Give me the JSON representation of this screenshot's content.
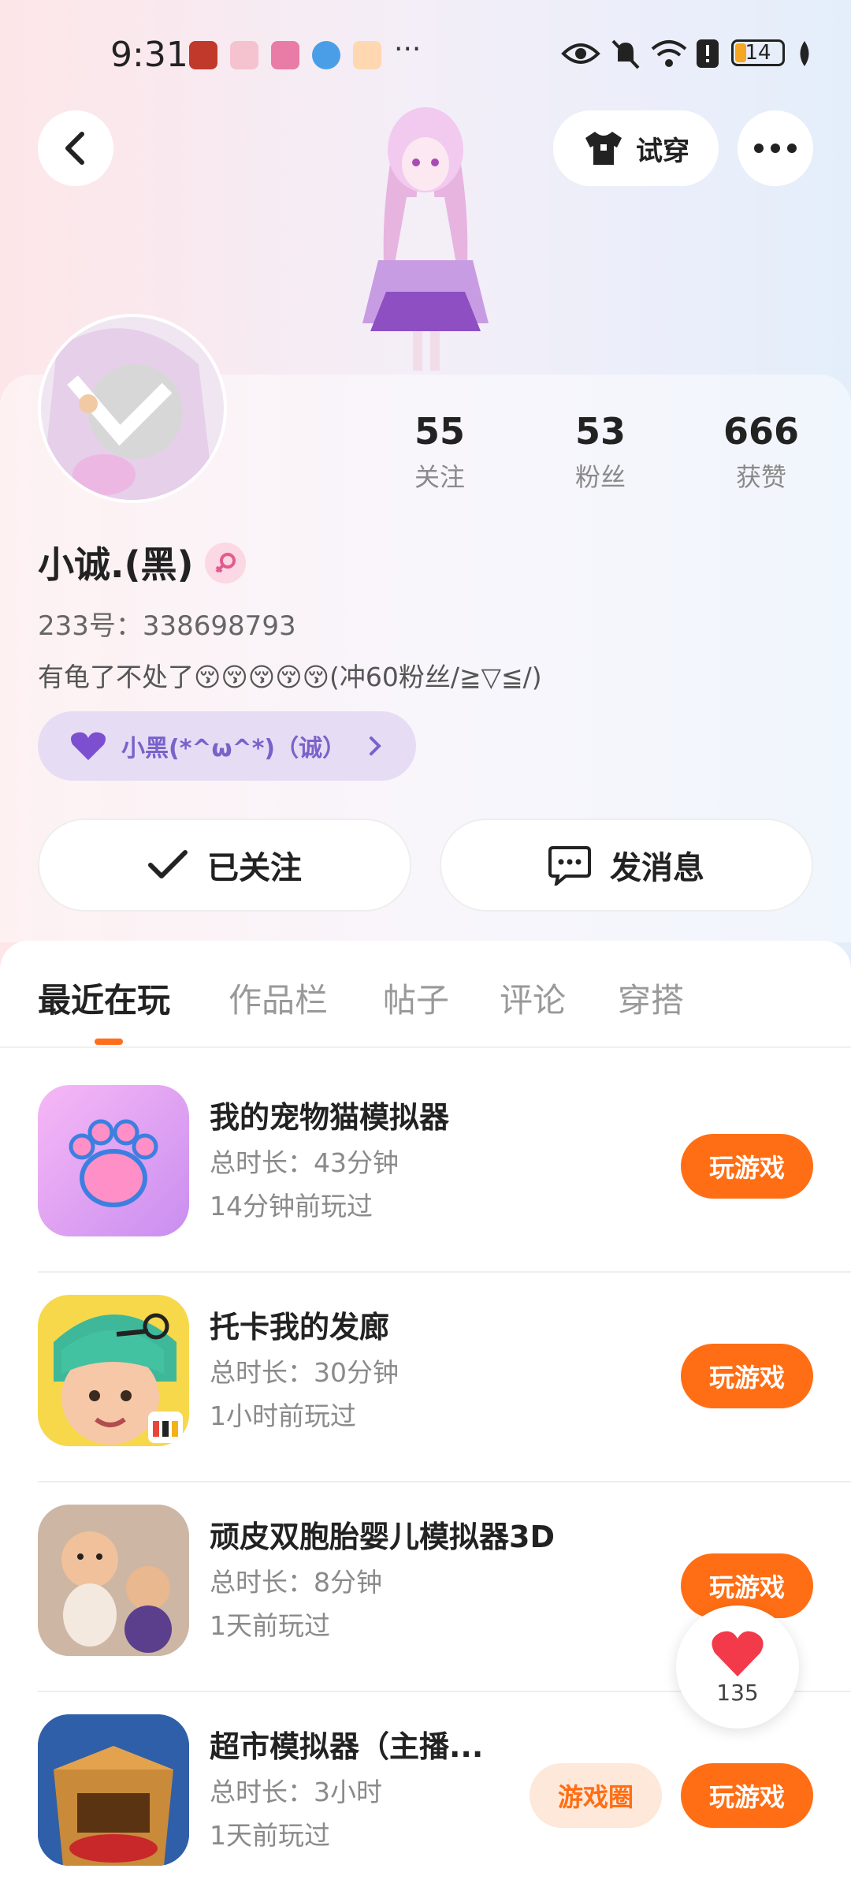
{
  "status_bar": {
    "time": "9:31",
    "more": "···",
    "battery": "14"
  },
  "header": {
    "tryon_label": "试穿"
  },
  "profile": {
    "stats": [
      {
        "num": "55",
        "label": "关注"
      },
      {
        "num": "53",
        "label": "粉丝"
      },
      {
        "num": "666",
        "label": "获赞"
      }
    ],
    "name": "小诚.(黑)",
    "id_text": "233号：338698793",
    "bio": "有龟了不处了😚😚😚😚😚(冲60粉丝/≧▽≦/)",
    "tag": "小黑(*^ω^*)（诚）"
  },
  "actions": {
    "followed": "已关注",
    "message": "发消息"
  },
  "tabs": [
    "最近在玩",
    "作品栏",
    "帖子",
    "评论",
    "穿搭"
  ],
  "games": [
    {
      "title": "我的宠物猫模拟器",
      "duration": "总时长：43分钟",
      "last": "14分钟前玩过",
      "play": "玩游戏"
    },
    {
      "title": "托卡我的发廊",
      "duration": "总时长：30分钟",
      "last": "1小时前玩过",
      "play": "玩游戏"
    },
    {
      "title": "顽皮双胞胎婴儿模拟器3D",
      "duration": "总时长：8分钟",
      "last": "1天前玩过",
      "play": "玩游戏"
    },
    {
      "title": "超市模拟器（主播...",
      "duration": "总时长：3小时",
      "last": "1天前玩过",
      "play": "玩游戏",
      "circle": "游戏圈"
    }
  ],
  "like_float": {
    "count": "135"
  },
  "colors": {
    "accent": "#ff6e14",
    "tag_bg": "#e6ddf5",
    "tag_text": "#7b62c9"
  },
  "icons": [
    "back-icon",
    "tshirt-icon",
    "more-icon",
    "eye-icon",
    "mute-icon",
    "wifi-icon",
    "heart-icon",
    "check-icon",
    "chat-icon",
    "paw-icon",
    "scissors-icon"
  ]
}
